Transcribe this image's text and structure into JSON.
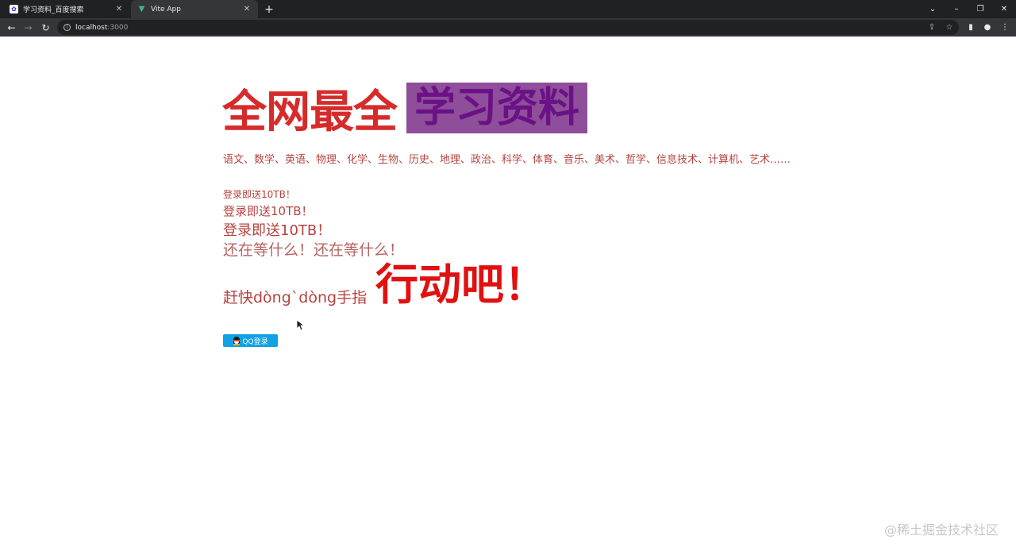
{
  "browser": {
    "tabs": [
      {
        "title": "学习资料_百度搜索",
        "favicon": "baidu-paw-icon",
        "active": false
      },
      {
        "title": "Vite App",
        "favicon": "vite-logo-icon",
        "active": true
      }
    ],
    "new_tab_label": "+",
    "address": {
      "host": "localhost",
      "port": ":3000"
    }
  },
  "page": {
    "headline_red": "全网最全",
    "headline_box": "学习资料",
    "subjects": "语文、数学、英语、物理、化学、生物、历史、地理、政治、科学、体育、音乐、美术、哲学、信息技术、计算机、艺术……",
    "promo_lines": [
      "登录即送10TB！",
      "登录即送10TB！",
      "登录即送10TB！"
    ],
    "waiting": "还在等什么！还在等什么！",
    "hurry": "赶快dòng`dòng手指",
    "action": "行动吧！",
    "qq_login_label": "QQ登录"
  },
  "colors": {
    "headline_red": "#d62b2b",
    "headline_box_bg": "#8e4e9a",
    "headline_box_text": "#6b1186",
    "body_text": "#b5433f",
    "action_red": "#e01111",
    "qq_blue": "#12a1e4"
  },
  "watermark": "@稀土掘金技术社区"
}
